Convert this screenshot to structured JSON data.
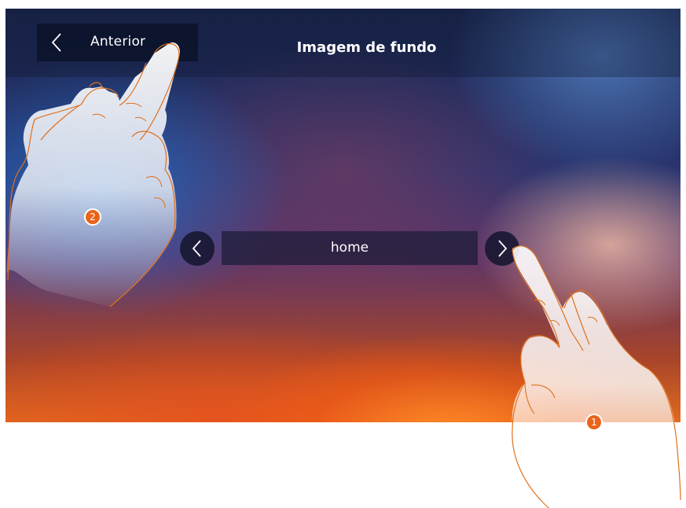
{
  "header": {
    "back_label": "Anterior",
    "title": "Imagem de fundo"
  },
  "selector": {
    "value": "home"
  },
  "callouts": {
    "step_1": "1",
    "step_2": "2"
  },
  "icons": {
    "back": "chevron-left-icon",
    "previous": "chevron-left-icon",
    "next": "chevron-right-icon",
    "hands": "pointing-hand-icon"
  },
  "colors": {
    "callout_badge": "#e8641a",
    "hand_outline": "#e0701c"
  }
}
